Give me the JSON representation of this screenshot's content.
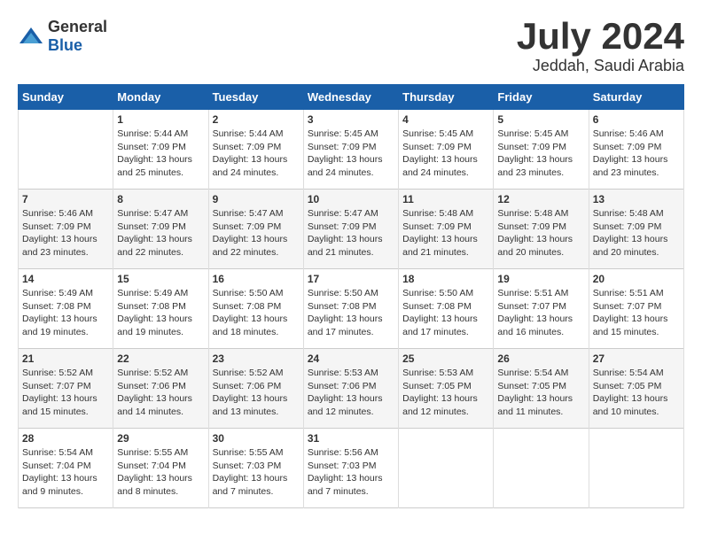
{
  "logo": {
    "general": "General",
    "blue": "Blue"
  },
  "title": {
    "month": "July 2024",
    "location": "Jeddah, Saudi Arabia"
  },
  "calendar": {
    "headers": [
      "Sunday",
      "Monday",
      "Tuesday",
      "Wednesday",
      "Thursday",
      "Friday",
      "Saturday"
    ],
    "weeks": [
      [
        {
          "day": "",
          "info": ""
        },
        {
          "day": "1",
          "info": "Sunrise: 5:44 AM\nSunset: 7:09 PM\nDaylight: 13 hours\nand 25 minutes."
        },
        {
          "day": "2",
          "info": "Sunrise: 5:44 AM\nSunset: 7:09 PM\nDaylight: 13 hours\nand 24 minutes."
        },
        {
          "day": "3",
          "info": "Sunrise: 5:45 AM\nSunset: 7:09 PM\nDaylight: 13 hours\nand 24 minutes."
        },
        {
          "day": "4",
          "info": "Sunrise: 5:45 AM\nSunset: 7:09 PM\nDaylight: 13 hours\nand 24 minutes."
        },
        {
          "day": "5",
          "info": "Sunrise: 5:45 AM\nSunset: 7:09 PM\nDaylight: 13 hours\nand 23 minutes."
        },
        {
          "day": "6",
          "info": "Sunrise: 5:46 AM\nSunset: 7:09 PM\nDaylight: 13 hours\nand 23 minutes."
        }
      ],
      [
        {
          "day": "7",
          "info": "Sunrise: 5:46 AM\nSunset: 7:09 PM\nDaylight: 13 hours\nand 23 minutes."
        },
        {
          "day": "8",
          "info": "Sunrise: 5:47 AM\nSunset: 7:09 PM\nDaylight: 13 hours\nand 22 minutes."
        },
        {
          "day": "9",
          "info": "Sunrise: 5:47 AM\nSunset: 7:09 PM\nDaylight: 13 hours\nand 22 minutes."
        },
        {
          "day": "10",
          "info": "Sunrise: 5:47 AM\nSunset: 7:09 PM\nDaylight: 13 hours\nand 21 minutes."
        },
        {
          "day": "11",
          "info": "Sunrise: 5:48 AM\nSunset: 7:09 PM\nDaylight: 13 hours\nand 21 minutes."
        },
        {
          "day": "12",
          "info": "Sunrise: 5:48 AM\nSunset: 7:09 PM\nDaylight: 13 hours\nand 20 minutes."
        },
        {
          "day": "13",
          "info": "Sunrise: 5:48 AM\nSunset: 7:09 PM\nDaylight: 13 hours\nand 20 minutes."
        }
      ],
      [
        {
          "day": "14",
          "info": "Sunrise: 5:49 AM\nSunset: 7:08 PM\nDaylight: 13 hours\nand 19 minutes."
        },
        {
          "day": "15",
          "info": "Sunrise: 5:49 AM\nSunset: 7:08 PM\nDaylight: 13 hours\nand 19 minutes."
        },
        {
          "day": "16",
          "info": "Sunrise: 5:50 AM\nSunset: 7:08 PM\nDaylight: 13 hours\nand 18 minutes."
        },
        {
          "day": "17",
          "info": "Sunrise: 5:50 AM\nSunset: 7:08 PM\nDaylight: 13 hours\nand 17 minutes."
        },
        {
          "day": "18",
          "info": "Sunrise: 5:50 AM\nSunset: 7:08 PM\nDaylight: 13 hours\nand 17 minutes."
        },
        {
          "day": "19",
          "info": "Sunrise: 5:51 AM\nSunset: 7:07 PM\nDaylight: 13 hours\nand 16 minutes."
        },
        {
          "day": "20",
          "info": "Sunrise: 5:51 AM\nSunset: 7:07 PM\nDaylight: 13 hours\nand 15 minutes."
        }
      ],
      [
        {
          "day": "21",
          "info": "Sunrise: 5:52 AM\nSunset: 7:07 PM\nDaylight: 13 hours\nand 15 minutes."
        },
        {
          "day": "22",
          "info": "Sunrise: 5:52 AM\nSunset: 7:06 PM\nDaylight: 13 hours\nand 14 minutes."
        },
        {
          "day": "23",
          "info": "Sunrise: 5:52 AM\nSunset: 7:06 PM\nDaylight: 13 hours\nand 13 minutes."
        },
        {
          "day": "24",
          "info": "Sunrise: 5:53 AM\nSunset: 7:06 PM\nDaylight: 13 hours\nand 12 minutes."
        },
        {
          "day": "25",
          "info": "Sunrise: 5:53 AM\nSunset: 7:05 PM\nDaylight: 13 hours\nand 12 minutes."
        },
        {
          "day": "26",
          "info": "Sunrise: 5:54 AM\nSunset: 7:05 PM\nDaylight: 13 hours\nand 11 minutes."
        },
        {
          "day": "27",
          "info": "Sunrise: 5:54 AM\nSunset: 7:05 PM\nDaylight: 13 hours\nand 10 minutes."
        }
      ],
      [
        {
          "day": "28",
          "info": "Sunrise: 5:54 AM\nSunset: 7:04 PM\nDaylight: 13 hours\nand 9 minutes."
        },
        {
          "day": "29",
          "info": "Sunrise: 5:55 AM\nSunset: 7:04 PM\nDaylight: 13 hours\nand 8 minutes."
        },
        {
          "day": "30",
          "info": "Sunrise: 5:55 AM\nSunset: 7:03 PM\nDaylight: 13 hours\nand 7 minutes."
        },
        {
          "day": "31",
          "info": "Sunrise: 5:56 AM\nSunset: 7:03 PM\nDaylight: 13 hours\nand 7 minutes."
        },
        {
          "day": "",
          "info": ""
        },
        {
          "day": "",
          "info": ""
        },
        {
          "day": "",
          "info": ""
        }
      ]
    ]
  }
}
